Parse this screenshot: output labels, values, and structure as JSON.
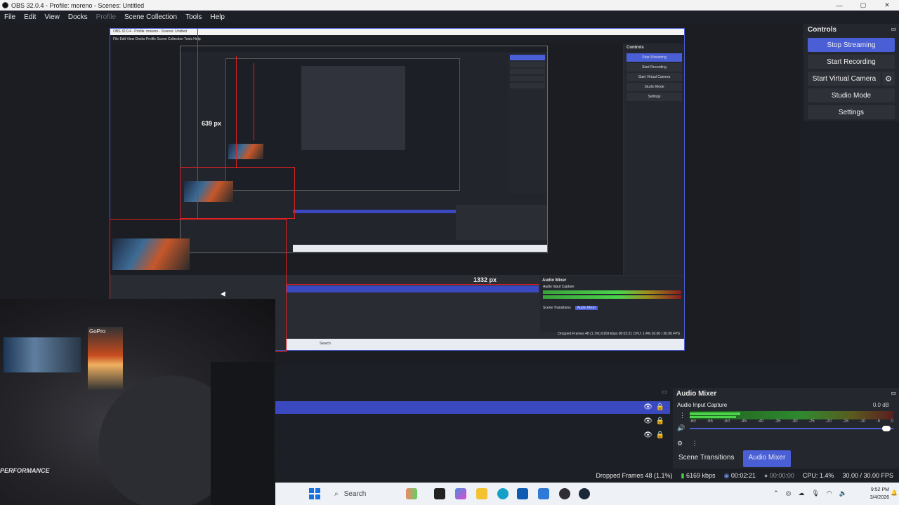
{
  "window": {
    "title": "OBS 32.0.4 - Profile: moreno - Scenes: Untitled",
    "minimize": "—",
    "maximize": "▢",
    "close": "✕"
  },
  "menu": {
    "file": "File",
    "edit": "Edit",
    "view": "View",
    "docks": "Docks",
    "profile": "Profile",
    "scene_collection": "Scene Collection",
    "tools": "Tools",
    "help": "Help"
  },
  "preview": {
    "height_label": "639 px",
    "width_label": "1332 px",
    "nested_title": "OBS 32.0.4 - Profile: moreno - Scenes: Untitled",
    "nested_menu": "File   Edit   View   Docks   Profile   Scene Collection   Tools   Help",
    "nested_controls": "Controls",
    "nested_buttons": [
      "Stop Streaming",
      "Start Recording",
      "Start Virtual Camera",
      "Studio Mode",
      "Settings"
    ],
    "nested_mixer": "Audio Mixer",
    "nested_mixer_source": "Audio Input Capture",
    "nested_db": "0.0 dB",
    "nested_tab_transitions": "Scene Transitions",
    "nested_tab_mixer": "Audio Mixer",
    "nested_status": "Dropped Frames 48 (1.1%)   6169 kbps   00:02:21   CPU: 1.4%   30.00 / 30.00 FPS",
    "nested_search": "Search",
    "camera_logo": "GoPro",
    "camera_brand": "PERFORMANCE"
  },
  "controls": {
    "title": "Controls",
    "stop_streaming": "Stop Streaming",
    "start_recording": "Start Recording",
    "start_virtual_camera": "Start Virtual Camera",
    "studio_mode": "Studio Mode",
    "settings": "Settings"
  },
  "mixer": {
    "title": "Audio Mixer",
    "source": "Audio Input Capture",
    "db": "0.0 dB",
    "scale": [
      "-60",
      "-55",
      "-50",
      "-45",
      "-40",
      "-35",
      "-30",
      "-25",
      "-20",
      "-15",
      "-10",
      "-5",
      "0"
    ]
  },
  "tabs": {
    "scene_transitions": "Scene Transitions",
    "audio_mixer": "Audio Mixer"
  },
  "status": {
    "dropped": "Dropped Frames 48 (1.1%)",
    "kbps": "6169 kbps",
    "stream_time": "00:02:21",
    "rec_time": "00:00:00",
    "cpu": "CPU: 1.4%",
    "fps": "30.00 / 30.00 FPS"
  },
  "taskbar": {
    "search": "Search",
    "time": "9:52 PM",
    "date": "3/4/2026"
  }
}
